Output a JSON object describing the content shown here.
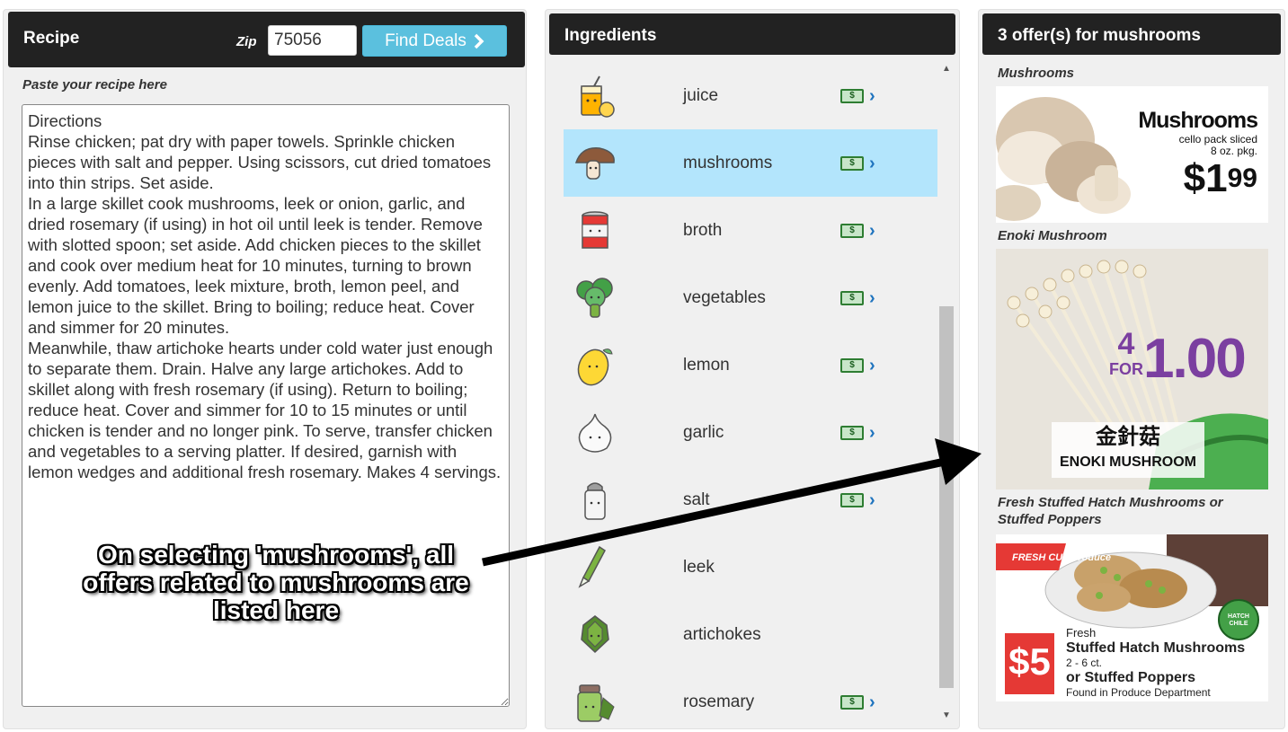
{
  "recipe": {
    "title": "Recipe",
    "zip_label": "Zip",
    "zip_value": "75056",
    "find_button": "Find Deals",
    "paste_label": "Paste your recipe here",
    "text": "Directions\nRinse chicken; pat dry with paper towels. Sprinkle chicken pieces with salt and pepper. Using scissors, cut dried tomatoes into thin strips. Set aside.\nIn a large skillet cook mushrooms, leek or onion, garlic, and dried rosemary (if using) in hot oil until leek is tender. Remove with slotted spoon; set aside. Add chicken pieces to the skillet and cook over medium heat for 10 minutes, turning to brown evenly. Add tomatoes, leek mixture, broth, lemon peel, and lemon juice to the skillet. Bring to boiling; reduce heat. Cover and simmer for 20 minutes.\nMeanwhile, thaw artichoke hearts under cold water just enough to separate them. Drain. Halve any large artichokes. Add to skillet along with fresh rosemary (if using). Return to boiling; reduce heat. Cover and simmer for 10 to 15 minutes or until chicken is tender and no longer pink. To serve, transfer chicken and vegetables to a serving platter. If desired, garnish with lemon wedges and additional fresh rosemary. Makes 4 servings."
  },
  "ingredients": {
    "title": "Ingredients",
    "items": [
      {
        "name": "juice",
        "icon": "juice-icon",
        "has_deal": true,
        "selected": false
      },
      {
        "name": "mushrooms",
        "icon": "mushroom-icon",
        "has_deal": true,
        "selected": true
      },
      {
        "name": "broth",
        "icon": "can-icon",
        "has_deal": true,
        "selected": false
      },
      {
        "name": "vegetables",
        "icon": "broccoli-icon",
        "has_deal": true,
        "selected": false
      },
      {
        "name": "lemon",
        "icon": "lemon-icon",
        "has_deal": true,
        "selected": false
      },
      {
        "name": "garlic",
        "icon": "garlic-icon",
        "has_deal": true,
        "selected": false
      },
      {
        "name": "salt",
        "icon": "salt-shaker-icon",
        "has_deal": true,
        "selected": false
      },
      {
        "name": "leek",
        "icon": "leek-icon",
        "has_deal": false,
        "selected": false
      },
      {
        "name": "artichokes",
        "icon": "artichoke-icon",
        "has_deal": false,
        "selected": false
      },
      {
        "name": "rosemary",
        "icon": "spice-jar-icon",
        "has_deal": true,
        "selected": false
      }
    ]
  },
  "offers": {
    "title": "3 offer(s) for mushrooms",
    "items": [
      {
        "label": "Mushrooms",
        "ad": {
          "headline": "Mushrooms",
          "sub1": "cello pack sliced",
          "sub2": "8 oz. pkg.",
          "price_dollar": "$1",
          "price_cents": "99"
        }
      },
      {
        "label": "Enoki Mushroom",
        "ad": {
          "qty": "4",
          "for": "FOR",
          "price": "1.00",
          "chinese": "金針菇",
          "name": "ENOKI MUSHROOM"
        }
      },
      {
        "label": "Fresh Stuffed Hatch Mushrooms or Stuffed Poppers",
        "ad": {
          "badge": "FRESH CUT",
          "badge2": "Produce",
          "price": "$5",
          "line1": "Fresh",
          "line2": "Stuffed Hatch Mushrooms",
          "line3": "2 - 6 ct.",
          "line4": "or Stuffed Poppers",
          "line5": "Found in Produce Department",
          "hatch": "HATCH CHILE"
        }
      }
    ]
  },
  "annotation": {
    "text": "On selecting 'mushrooms', all offers related to mushrooms are listed here"
  },
  "colors": {
    "header_bg": "#222222",
    "button_bg": "#5bc0de",
    "selected_row": "#b3e5fc",
    "deal_green": "#2e7d32",
    "chevron_blue": "#1e73be"
  }
}
